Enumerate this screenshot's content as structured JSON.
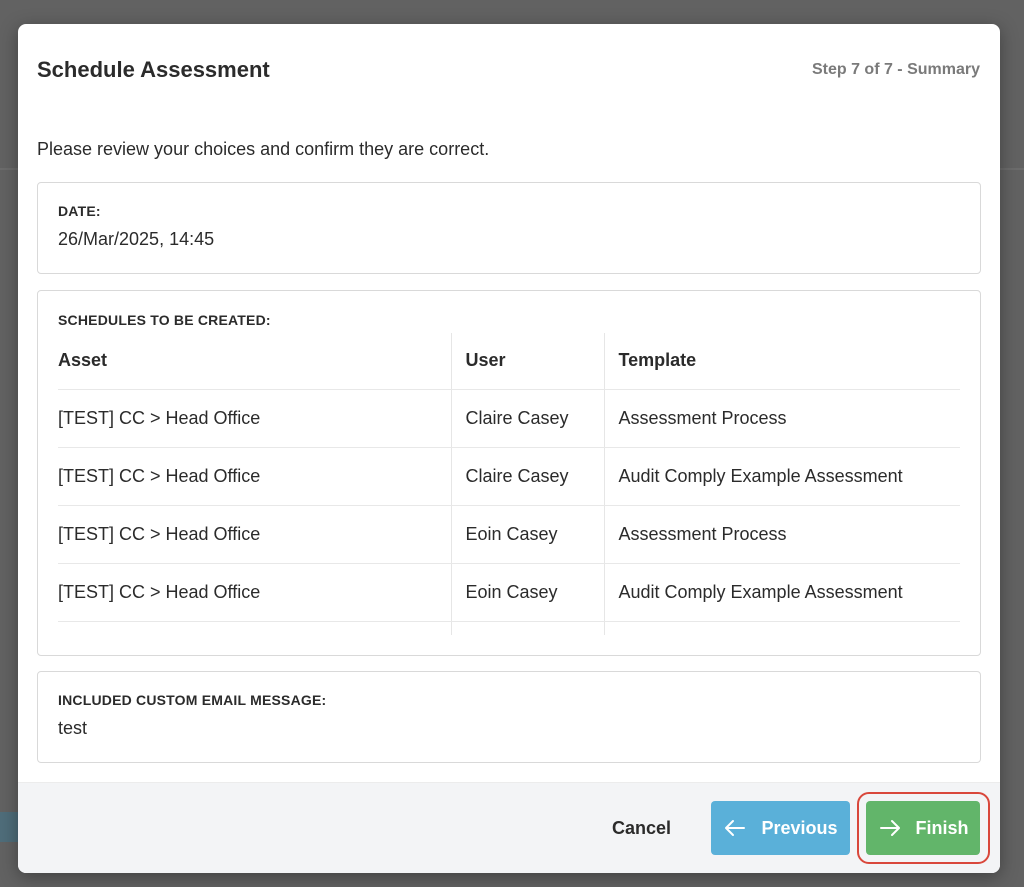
{
  "modal": {
    "title": "Schedule Assessment",
    "step": "Step 7 of 7 - Summary",
    "intro": "Please review your choices and confirm they are correct."
  },
  "date_card": {
    "label": "DATE:",
    "value": "26/Mar/2025, 14:45"
  },
  "schedules_card": {
    "label": "SCHEDULES TO BE CREATED:",
    "columns": [
      "Asset",
      "User",
      "Template"
    ],
    "rows": [
      [
        "[TEST] CC > Head Office",
        "Claire Casey",
        "Assessment Process"
      ],
      [
        "[TEST] CC > Head Office",
        "Claire Casey",
        "Audit Comply Example Assessment"
      ],
      [
        "[TEST] CC > Head Office",
        "Eoin Casey",
        "Assessment Process"
      ],
      [
        "[TEST] CC > Head Office",
        "Eoin Casey",
        "Audit Comply Example Assessment"
      ]
    ]
  },
  "email_card": {
    "label": "INCLUDED CUSTOM EMAIL MESSAGE:",
    "value": "test"
  },
  "footer": {
    "cancel_label": "Cancel",
    "previous_label": "Previous",
    "previous_icon": "arrow-left-icon",
    "finish_label": "Finish",
    "finish_icon": "arrow-right-icon"
  },
  "colors": {
    "previous_button": "#5ab0d9",
    "finish_button": "#62b56a",
    "highlight_ring": "#d9473b"
  }
}
